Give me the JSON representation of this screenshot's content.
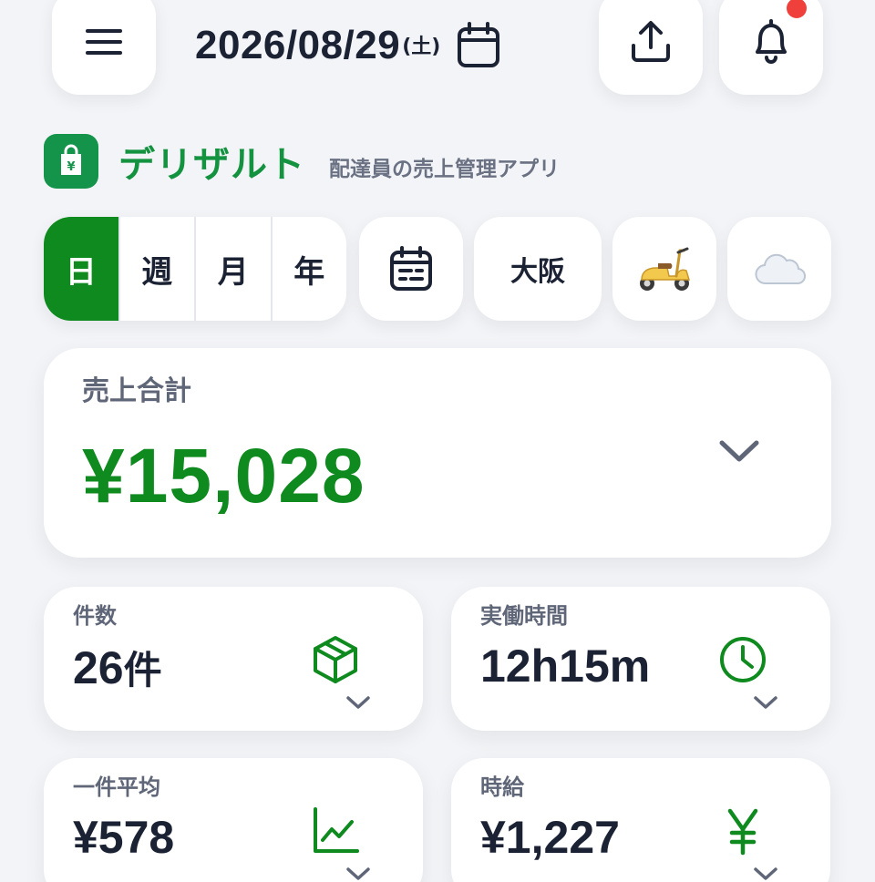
{
  "header": {
    "date": "2026/08/29",
    "weekday": "(土)"
  },
  "brand": {
    "name": "デリザルト",
    "tagline": "配達員の売上管理アプリ",
    "logo_mark": "¥"
  },
  "filters": {
    "periods": [
      "日",
      "週",
      "月",
      "年"
    ],
    "active_period": "日",
    "area": "大阪",
    "vehicle_emoji": "🛵",
    "weather_emoji": "☁️"
  },
  "total": {
    "label": "売上合計",
    "value": "¥15,028"
  },
  "stats": {
    "count": {
      "label": "件数",
      "value": "26",
      "unit": "件"
    },
    "hours": {
      "label": "実働時間",
      "value": "12h15m",
      "unit": ""
    },
    "average": {
      "label": "一件平均",
      "value": "¥578",
      "unit": ""
    },
    "hourly": {
      "label": "時給",
      "value": "¥1,227",
      "unit": ""
    }
  },
  "icons": {
    "menu": "menu-icon",
    "calendar": "calendar-icon",
    "share": "share-upload-icon",
    "bell": "bell-icon",
    "package": "package-icon",
    "clock": "clock-icon",
    "chart": "line-chart-icon",
    "yen": "yen-icon",
    "chevron": "chevron-down-icon"
  },
  "colors": {
    "accent_green": "#0e8a1e",
    "brand_green": "#13923f",
    "text_dark": "#1b2234",
    "text_muted": "#5f6678",
    "notification": "#f0403c",
    "background": "#f3f4f7"
  }
}
